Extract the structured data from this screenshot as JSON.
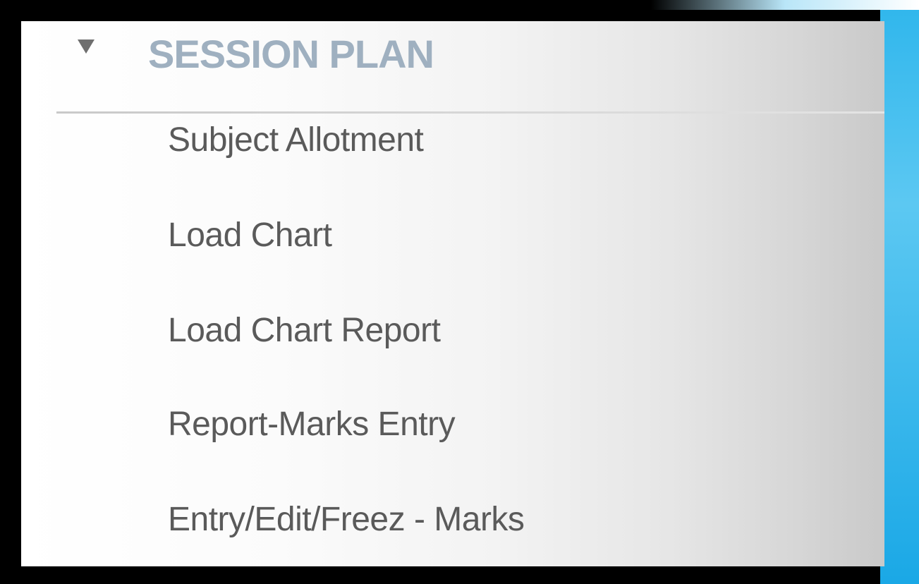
{
  "section": {
    "title": "SESSION PLAN",
    "expanded": true,
    "caret_icon": "caret-down-icon"
  },
  "menu": {
    "items": [
      {
        "label": "Subject Allotment"
      },
      {
        "label": "Load Chart"
      },
      {
        "label": "Load Chart Report"
      },
      {
        "label": "Report-Marks Entry"
      },
      {
        "label": "Entry/Edit/Freez - Marks"
      }
    ]
  },
  "colors": {
    "title": "#9fb0c0",
    "item_text": "#5a5a5a",
    "caret": "#6f6f6f",
    "accent_edge": "#2fb6ec"
  }
}
